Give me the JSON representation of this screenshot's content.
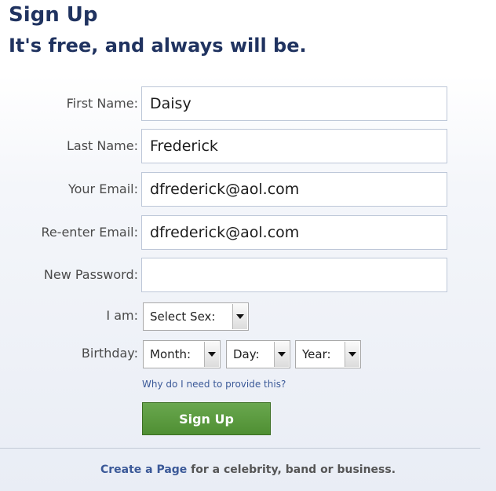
{
  "header": {
    "title": "Sign Up",
    "subtitle": "It's free, and always will be."
  },
  "form": {
    "first_name": {
      "label": "First Name:",
      "value": "Daisy"
    },
    "last_name": {
      "label": "Last Name:",
      "value": "Frederick"
    },
    "email": {
      "label": "Your Email:",
      "value": "dfrederick@aol.com"
    },
    "reenter_email": {
      "label": "Re-enter Email:",
      "value": "dfrederick@aol.com"
    },
    "new_password": {
      "label": "New Password:",
      "value": ""
    },
    "sex": {
      "label": "I am:",
      "selected": "Select Sex:"
    },
    "birthday": {
      "label": "Birthday:",
      "month": "Month:",
      "day": "Day:",
      "year": "Year:"
    },
    "why_link": "Why do I need to provide this?",
    "submit_label": "Sign Up"
  },
  "footer": {
    "link_text": "Create a Page",
    "rest_text": " for a celebrity, band or business."
  },
  "colors": {
    "title": "#203360",
    "link": "#3b5998",
    "button": "#5a9a3f",
    "input_border": "#bdc7d8"
  },
  "icons": {
    "dropdown": "chevron-down-icon"
  }
}
